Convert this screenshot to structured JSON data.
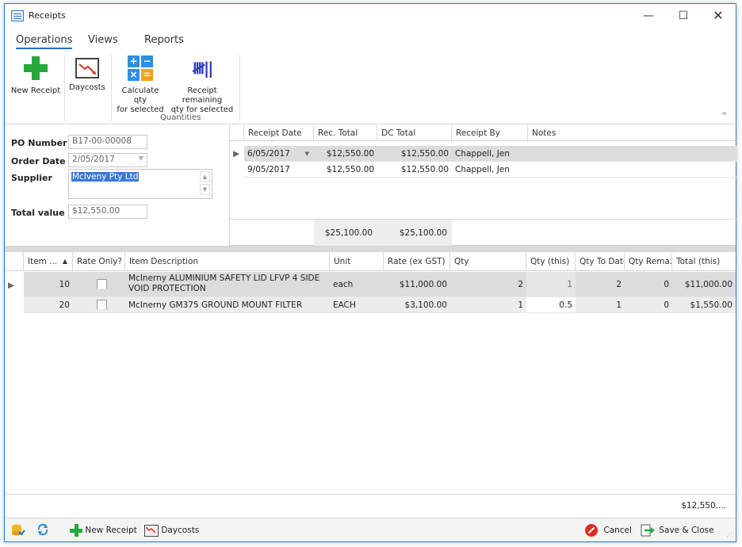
{
  "window": {
    "title": "Receipts",
    "controls": {
      "minimize": "—",
      "maximize": "☐",
      "close": "✕"
    }
  },
  "ribbon": {
    "tabs": [
      "Operations",
      "Views",
      "Reports"
    ],
    "buttons": {
      "new_receipt": "New Receipt",
      "daycosts": "Daycosts",
      "calc_qty_1": "Calculate qty",
      "calc_qty_2": "for selected",
      "receipt_remaining_1": "Receipt remaining",
      "receipt_remaining_2": "qty for selected"
    },
    "group_label": "Quantities",
    "collapse_glyph": "^",
    "icons": {
      "new_receipt": "plus-icon",
      "daycosts": "chart-down-icon",
      "calc": "calculator-icon",
      "tally": "tally-icon"
    }
  },
  "form": {
    "po_number_label": "PO Number",
    "po_number": "B17-00-00008",
    "order_date_label": "Order Date",
    "order_date": "2/05/2017",
    "supplier_label": "Supplier",
    "supplier": "McIveny Pty Ltd",
    "total_value_label": "Total value",
    "total_value": "$12,550.00"
  },
  "receipts_grid": {
    "columns": [
      "Receipt Date",
      "Rec. Total",
      "DC Total",
      "Receipt By",
      "Notes"
    ],
    "rows": [
      {
        "date": "6/05/2017",
        "rec_total": "$12,550.00",
        "dc_total": "$12,550.00",
        "by": "Chappell, Jen",
        "notes": ""
      },
      {
        "date": "9/05/2017",
        "rec_total": "$12,550.00",
        "dc_total": "$12,550.00",
        "by": "Chappell, Jen",
        "notes": ""
      }
    ],
    "footer": {
      "rec_total": "$25,100.00",
      "dc_total": "$25,100.00"
    }
  },
  "items_grid": {
    "columns": [
      "Item ...",
      "Rate Only?",
      "Item Description",
      "Unit",
      "Rate  (ex GST)",
      "Qty",
      "Qty (this)",
      "Qty To Date",
      "Qty Rema...",
      "Total (this)"
    ],
    "rows": [
      {
        "item": "10",
        "desc_1": "McInerny ALUMINIUM SAFETY LID LFVP 4 SIDE",
        "desc_2": "VOID PROTECTION",
        "unit": "each",
        "rate": "$11,000.00",
        "qty": "2",
        "qty_this": "1",
        "qty_to_date": "2",
        "qty_rem": "0",
        "total": "$11,000.00"
      },
      {
        "item": "20",
        "desc_1": "McInerny GM375 GROUND MOUNT FILTER",
        "desc_2": "",
        "unit": "EACH",
        "rate": "$3,100.00",
        "qty": "1",
        "qty_this": "0.5",
        "qty_to_date": "1",
        "qty_rem": "0",
        "total": "$1,550.00"
      }
    ],
    "footer_total": "$12,550...."
  },
  "statusbar": {
    "new_receipt": "New Receipt",
    "daycosts": "Daycosts",
    "cancel": "Cancel",
    "save_close": "Save & Close",
    "grip": "⋰"
  },
  "colors": {
    "accent": "#2b6cc4",
    "green": "#25a83c",
    "cancel_red": "#d93025"
  }
}
